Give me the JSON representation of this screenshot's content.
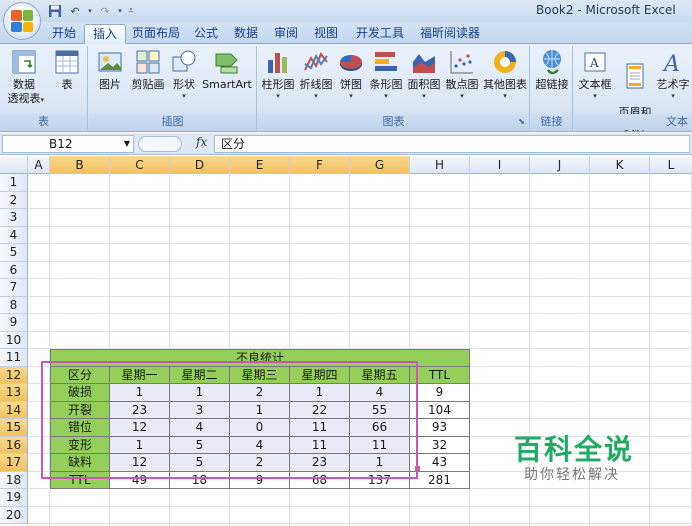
{
  "window": {
    "title": "Book2 - Microsoft Excel"
  },
  "tabs": [
    "开始",
    "插入",
    "页面布局",
    "公式",
    "数据",
    "审阅",
    "视图",
    "开发工具",
    "福昕阅读器"
  ],
  "active_tab": "插入",
  "ribbon": {
    "groups": [
      {
        "label": "表",
        "buttons": [
          {
            "label": "数据\n透视表",
            "icon": "pivot-table-icon"
          },
          {
            "label": "表",
            "icon": "table-icon"
          }
        ]
      },
      {
        "label": "插图",
        "buttons": [
          {
            "label": "图片",
            "icon": "picture-icon"
          },
          {
            "label": "剪贴画",
            "icon": "clipart-icon"
          },
          {
            "label": "形状",
            "icon": "shapes-icon"
          },
          {
            "label": "SmartArt",
            "icon": "smartart-icon"
          }
        ]
      },
      {
        "label": "图表",
        "buttons": [
          {
            "label": "柱形图",
            "icon": "column-chart-icon"
          },
          {
            "label": "折线图",
            "icon": "line-chart-icon"
          },
          {
            "label": "饼图",
            "icon": "pie-chart-icon"
          },
          {
            "label": "条形图",
            "icon": "bar-chart-icon"
          },
          {
            "label": "面积图",
            "icon": "area-chart-icon"
          },
          {
            "label": "散点图",
            "icon": "scatter-chart-icon"
          },
          {
            "label": "其他图表",
            "icon": "other-charts-icon"
          }
        ]
      },
      {
        "label": "链接",
        "buttons": [
          {
            "label": "超链接",
            "icon": "hyperlink-icon"
          }
        ]
      },
      {
        "label": "文本",
        "buttons": [
          {
            "label": "文本框",
            "icon": "textbox-icon"
          },
          {
            "label": "页眉和\n页脚",
            "icon": "header-footer-icon"
          },
          {
            "label": "艺术字",
            "icon": "wordart-icon"
          }
        ]
      }
    ]
  },
  "formula_bar": {
    "name_box": "B12",
    "fx": "fx",
    "content": "区分"
  },
  "columns": [
    "A",
    "B",
    "C",
    "D",
    "E",
    "F",
    "G",
    "H",
    "I",
    "J",
    "K",
    "L"
  ],
  "selected_columns": [
    "B",
    "C",
    "D",
    "E",
    "F",
    "G"
  ],
  "rows": [
    "1",
    "2",
    "3",
    "4",
    "5",
    "6",
    "7",
    "8",
    "9",
    "10",
    "11",
    "12",
    "13",
    "14",
    "15",
    "16",
    "17",
    "18",
    "19",
    "20"
  ],
  "selected_rows": [
    "12",
    "13",
    "14",
    "15",
    "16",
    "17"
  ],
  "table": {
    "title": "不良统计",
    "headers": [
      "区分",
      "星期一",
      "星期二",
      "星期三",
      "星期四",
      "星期五",
      "TTL"
    ],
    "body": [
      [
        "破损",
        "1",
        "1",
        "2",
        "1",
        "4",
        "9"
      ],
      [
        "开裂",
        "23",
        "3",
        "1",
        "22",
        "55",
        "104"
      ],
      [
        "错位",
        "12",
        "4",
        "0",
        "11",
        "66",
        "93"
      ],
      [
        "变形",
        "1",
        "5",
        "4",
        "11",
        "11",
        "32"
      ],
      [
        "缺料",
        "12",
        "5",
        "2",
        "23",
        "1",
        "43"
      ]
    ],
    "total": [
      "TTL",
      "49",
      "18",
      "9",
      "68",
      "137",
      "281"
    ]
  },
  "watermark": {
    "main": "百科全说",
    "sub": "助你轻松解决"
  },
  "colors": {
    "green_fill": "#93cf5a",
    "lavender_fill": "#ebebf7",
    "selection": "#cc55b5",
    "watermark": "#1faa62"
  }
}
